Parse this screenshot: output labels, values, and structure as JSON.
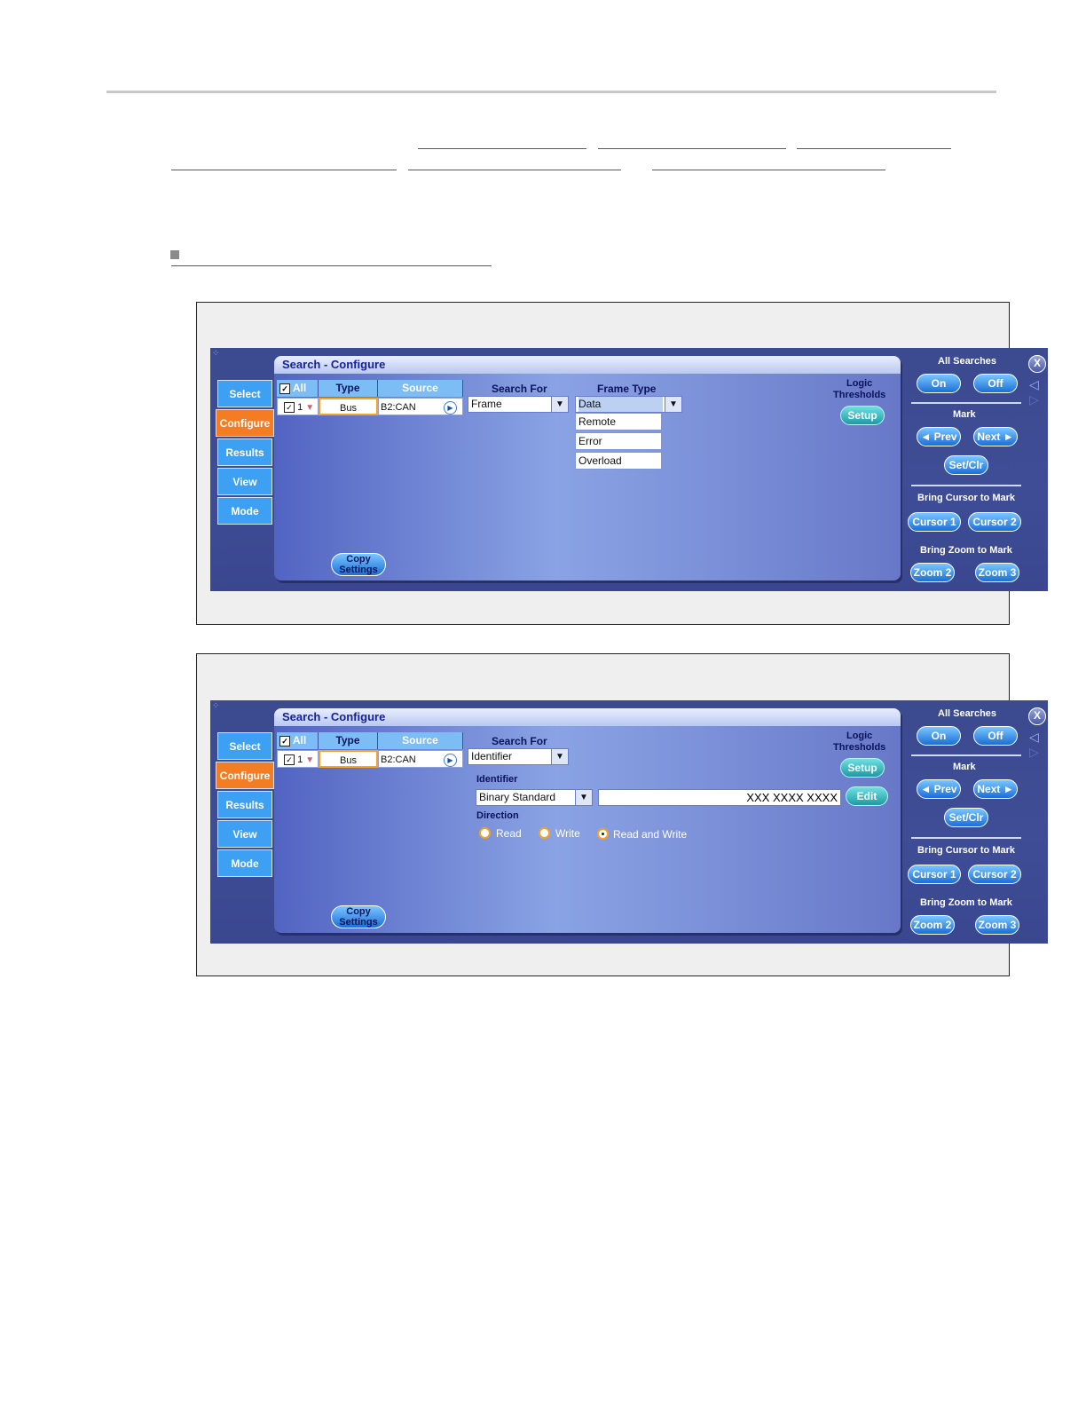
{
  "shared": {
    "tabs": [
      "Select",
      "Configure",
      "Results",
      "View",
      "Mode"
    ],
    "panel_title": "Search - Configure",
    "col_all": "All",
    "col_type": "Type",
    "col_source": "Source",
    "row_num": "1",
    "row_type": "Bus",
    "row_source": "B2:CAN",
    "search_for_label": "Search For",
    "logic_thresholds": "Logic\nThresholds",
    "setup_label": "Setup",
    "copy_settings": "Copy\nSettings",
    "all_searches": "All Searches",
    "on_label": "On",
    "off_label": "Off",
    "mark_label": "Mark",
    "prev_label": "◄ Prev",
    "next_label": "Next ►",
    "setclr_label": "Set/Clr",
    "bring_cursor": "Bring Cursor to Mark",
    "cursor1": "Cursor 1",
    "cursor2": "Cursor 2",
    "bring_zoom": "Bring Zoom to Mark",
    "zoom2": "Zoom 2",
    "zoom3": "Zoom 3",
    "close_label": "X"
  },
  "fig1": {
    "search_for_value": "Frame",
    "frame_type_label": "Frame Type",
    "frame_type_value": "Data",
    "frame_type_options": [
      "Remote",
      "Error",
      "Overload"
    ]
  },
  "fig2": {
    "search_for_value": "Identifier",
    "identifier_label": "Identifier",
    "identifier_format": "Binary Standard",
    "identifier_value": "XXX XXXX XXXX",
    "edit_label": "Edit",
    "direction_label": "Direction",
    "direction_options": [
      "Read",
      "Write",
      "Read and Write"
    ],
    "direction_selected": "Read and Write"
  },
  "colors": {
    "panel_bg": "#3e4d96",
    "tab_blue": "#3ea0f2",
    "tab_active": "#f47c22",
    "title_text": "#15229c"
  }
}
